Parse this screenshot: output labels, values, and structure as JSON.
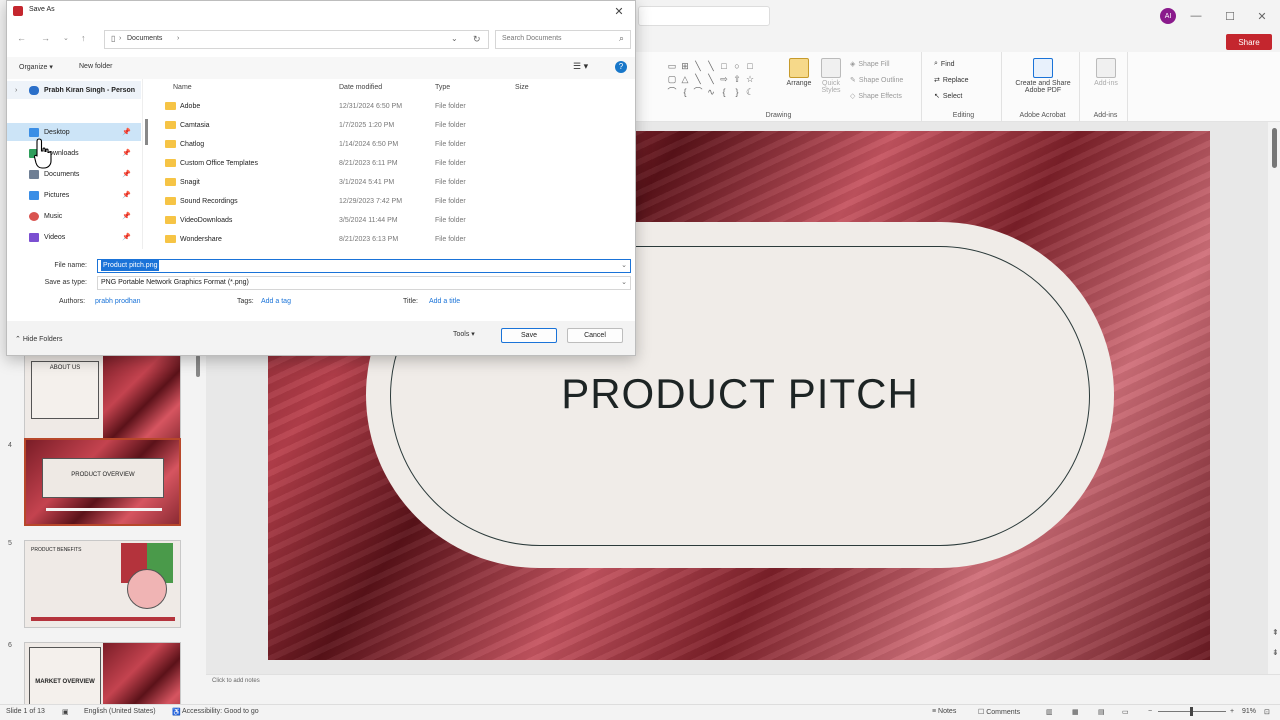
{
  "powerpoint": {
    "avatar_initials": "AI",
    "share_label": "Share",
    "window_controls": {
      "minimize": "—",
      "maximize": "☐",
      "close": "✕"
    },
    "ribbon": {
      "groups": {
        "drawing": "Drawing",
        "editing": "Editing",
        "adobe": "Adobe Acrobat",
        "addins": "Add-ins"
      },
      "arrange": "Arrange",
      "quick_styles": "Quick Styles",
      "shape_fill": "Shape Fill",
      "shape_outline": "Shape Outline",
      "shape_effects": "Shape Effects",
      "find": "Find",
      "replace": "Replace",
      "select": "Select",
      "create_pdf": "Create and Share Adobe PDF",
      "addins_btn": "Add-ins"
    },
    "thumbnails": [
      {
        "num": "3",
        "title": "ABOUT US"
      },
      {
        "num": "4",
        "title": "PRODUCT OVERVIEW"
      },
      {
        "num": "5",
        "title": "PRODUCT BENEFITS"
      },
      {
        "num": "6",
        "title": "MARKET OVERVIEW"
      }
    ],
    "slide": {
      "title": "PRODUCT PITCH"
    },
    "notes_placeholder": "Click to add notes",
    "status": {
      "slide_counter": "Slide 1 of 13",
      "language": "English (United States)",
      "accessibility": "Accessibility: Good to go",
      "notes": "Notes",
      "comments": "Comments",
      "zoom": "91%"
    }
  },
  "dialog": {
    "title": "Save As",
    "address": {
      "location": "Documents",
      "search_placeholder": "Search Documents"
    },
    "toolbar": {
      "organize": "Organize",
      "new_folder": "New folder"
    },
    "nav_pane": {
      "account": "Prabh Kiran Singh - Person",
      "items": [
        {
          "label": "Desktop",
          "color": "#3a8ee6"
        },
        {
          "label": "Downloads",
          "color": "#2e9e5b"
        },
        {
          "label": "Documents",
          "color": "#6f7f95"
        },
        {
          "label": "Pictures",
          "color": "#3a8ee6"
        },
        {
          "label": "Music",
          "color": "#d9534f"
        },
        {
          "label": "Videos",
          "color": "#7b4fd1"
        }
      ]
    },
    "columns": {
      "name": "Name",
      "date": "Date modified",
      "type": "Type",
      "size": "Size"
    },
    "files": [
      {
        "name": "Adobe",
        "date": "12/31/2024 6:50 PM",
        "type": "File folder"
      },
      {
        "name": "Camtasia",
        "date": "1/7/2025 1:20 PM",
        "type": "File folder"
      },
      {
        "name": "Chatlog",
        "date": "1/14/2024 6:50 PM",
        "type": "File folder"
      },
      {
        "name": "Custom Office Templates",
        "date": "8/21/2023 6:11 PM",
        "type": "File folder"
      },
      {
        "name": "Snagit",
        "date": "3/1/2024 5:41 PM",
        "type": "File folder"
      },
      {
        "name": "Sound Recordings",
        "date": "12/29/2023 7:42 PM",
        "type": "File folder"
      },
      {
        "name": "VideoDownloads",
        "date": "3/5/2024 11:44 PM",
        "type": "File folder"
      },
      {
        "name": "Wondershare",
        "date": "8/21/2023 6:13 PM",
        "type": "File folder"
      }
    ],
    "fields": {
      "filename_label": "File name:",
      "filename_value": "Product pitch.png",
      "savetype_label": "Save as type:",
      "savetype_value": "PNG Portable Network Graphics Format (*.png)",
      "authors_label": "Authors:",
      "authors_value": "prabh prodhan",
      "tags_label": "Tags:",
      "tags_value": "Add a tag",
      "title_label": "Title:",
      "title_value": "Add a title"
    },
    "footer": {
      "hide_folders": "Hide Folders",
      "tools": "Tools",
      "save": "Save",
      "cancel": "Cancel"
    }
  }
}
